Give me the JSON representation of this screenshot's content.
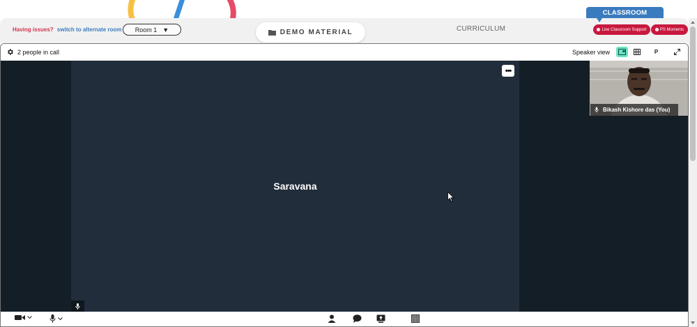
{
  "topbar": {
    "issues_text": "Having issues?",
    "switch_link": "switch to alternate room",
    "room_value": "Room 1",
    "demo_label": "DEMO MATERIAL",
    "curriculum_label": "CURRICULUM",
    "classroom_label": "CLASSROOM",
    "live_support_label": "Live Classroom Support",
    "ps_moments_label": "PS Moments"
  },
  "call": {
    "people_count": "2 people in call",
    "view_label": "Speaker view",
    "p_label": "P",
    "speaker_name": "Saravana",
    "self_name": "Bikash Kishore das (You)"
  },
  "colors": {
    "accent_blue": "#3a7bbf",
    "alert_red": "#c8183f",
    "active_view": "#6ee3c5",
    "stage_bg": "#141e26",
    "tile_bg": "#212d3b"
  }
}
